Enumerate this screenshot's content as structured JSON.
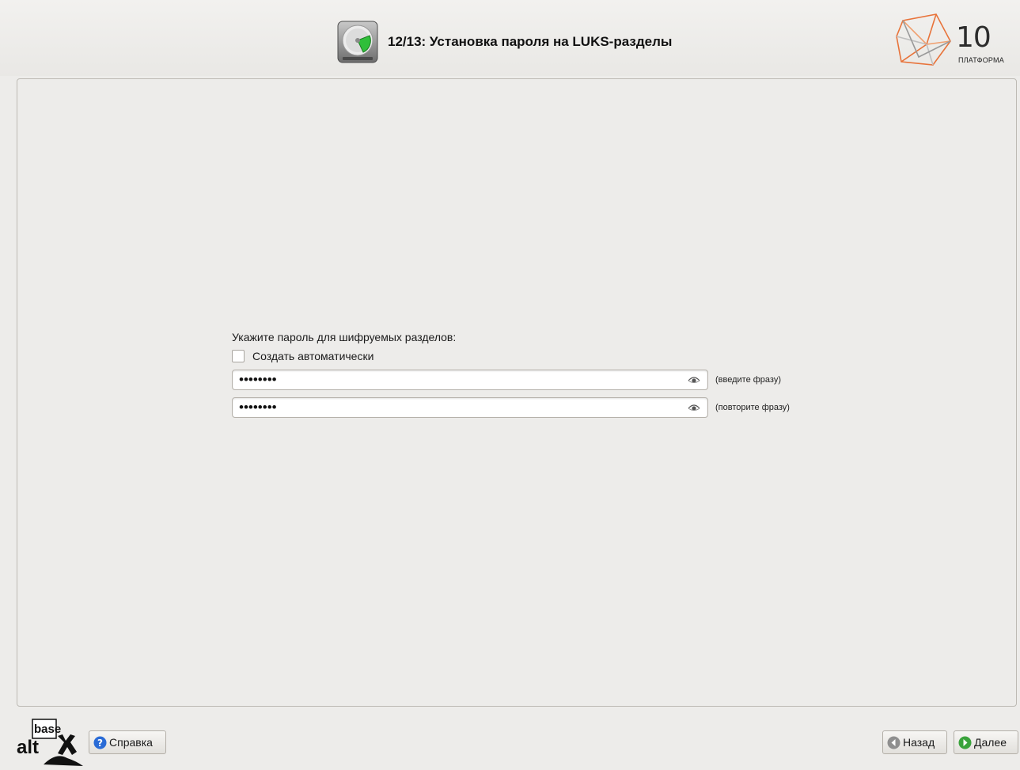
{
  "header": {
    "title": "12/13: Установка пароля на LUKS-разделы",
    "step_icon": "disk-partition-icon",
    "brand": {
      "number": "10",
      "subtitle": "ПЛАТФОРМА"
    }
  },
  "form": {
    "prompt": "Укажите пароль для шифруемых разделов:",
    "auto_checkbox": {
      "label": "Создать автоматически",
      "checked": false
    },
    "password": {
      "value": "••••••••",
      "hint": "(введите фразу)",
      "icon": "eye-icon"
    },
    "confirm": {
      "value": "••••••••",
      "hint": "(повторите фразу)",
      "icon": "eye-icon"
    }
  },
  "footer": {
    "logo": {
      "line1": "base",
      "line2": "alt"
    },
    "help_label": "Справка",
    "back_label": "Назад",
    "next_label": "Далее"
  },
  "colors": {
    "background": "#edecea",
    "brand_orange": "#e8733a",
    "next_green": "#3aa33c",
    "help_blue": "#2a6bd6"
  }
}
